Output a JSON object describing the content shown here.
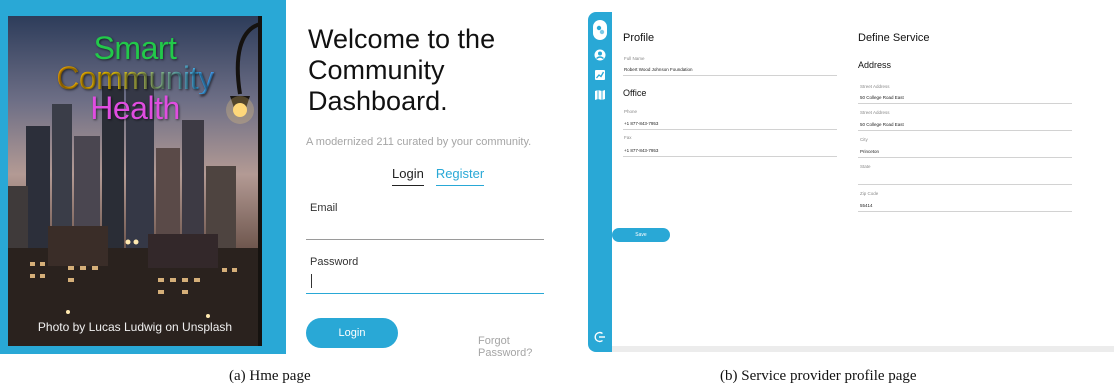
{
  "home": {
    "hero_title": [
      "Smart",
      "Community",
      "Health"
    ],
    "photo_credit": "Photo by Lucas Ludwig on Unsplash",
    "welcome_lines": [
      "Welcome to the",
      "Community",
      "Dashboard."
    ],
    "tagline": "A modernized 211 curated by your community.",
    "tabs": {
      "login": "Login",
      "register": "Register"
    },
    "email_label": "Email",
    "password_label": "Password",
    "login_button": "Login",
    "forgot_link": "Forgot Password?"
  },
  "profile_page": {
    "profile_title": "Profile",
    "full_name_label": "Full Name",
    "full_name_value": "Robert Wood Johnson Foundation",
    "office_title": "Office",
    "phone_label": "Phone",
    "phone_value": "+1 877-843-7953",
    "fax_label": "Fax",
    "fax_value": "+1 877-843-7953",
    "define_service_title": "Define Service",
    "address_title": "Address",
    "street1_label": "Street Address",
    "street1_value": "50 College Road East",
    "street2_label": "Street Address",
    "street2_value": "50 College Road East",
    "city_label": "City",
    "city_value": "Princeton",
    "state_label": "State",
    "state_value": "",
    "zip_label": "Zip Code",
    "zip_value": "55414",
    "save_button": "Save"
  },
  "captions": {
    "a": "(a) Hme page",
    "b": "(b) Service provider profile page"
  },
  "colors": {
    "accent": "#29a8d6",
    "text": "#222222",
    "muted": "#a5a5a5"
  },
  "icons": [
    "user-icon",
    "chart-icon",
    "map-icon",
    "logout-icon"
  ]
}
